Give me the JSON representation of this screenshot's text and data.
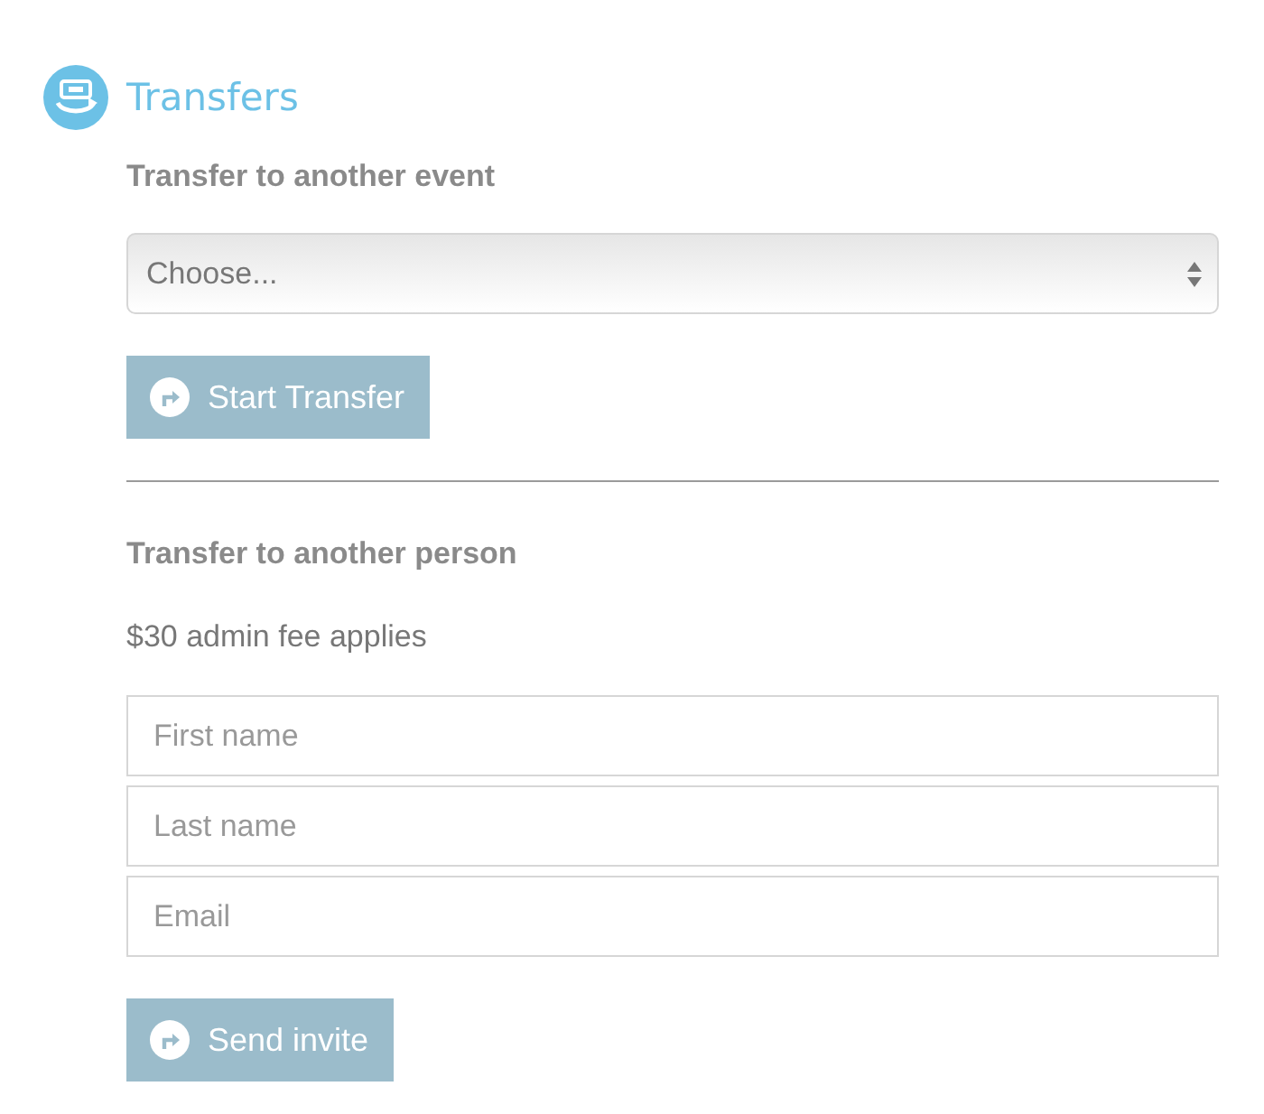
{
  "section": {
    "title": "Transfers"
  },
  "event_transfer": {
    "heading": "Transfer to another event",
    "select": {
      "value": "Choose..."
    },
    "button": "Start Transfer"
  },
  "person_transfer": {
    "heading": "Transfer to another person",
    "note": "$30 admin fee applies",
    "fields": [
      {
        "placeholder": "First name"
      },
      {
        "placeholder": "Last name"
      },
      {
        "placeholder": "Email"
      }
    ],
    "button": "Send invite"
  }
}
